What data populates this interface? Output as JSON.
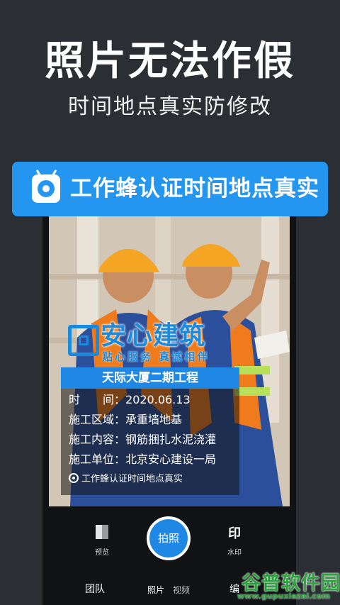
{
  "promo": {
    "headline": "照片无法作假",
    "subheadline": "时间地点真实防修改"
  },
  "banner": {
    "icon": "camera-icon",
    "text": "工作蜂认证时间地点真实"
  },
  "watermark": {
    "brand": "安心建筑",
    "slogan": "贴心服务 真诚相伴",
    "project_title": "天际大厦二期工程",
    "rows": [
      {
        "label": "时　　间：",
        "value": "2020.06.13"
      },
      {
        "label": "施工区域：",
        "value": "承重墙地基"
      },
      {
        "label": "施工内容：",
        "value": "钢筋捆扎水泥浇灌"
      },
      {
        "label": "施工单位：",
        "value": "北京安心建设一局"
      }
    ],
    "footer": "工作蜂认证时间地点真实"
  },
  "camera": {
    "preview_label": "预览",
    "shutter_label": "拍照",
    "stamp_icon_text": "印",
    "watermark_label": "水印"
  },
  "tabs": {
    "team": "团队",
    "photo": "照片",
    "video": "视频",
    "edit": "编"
  },
  "site_watermark": {
    "name": "谷普软件园",
    "url": "www.gupuxiazai.com",
    "color": "#2aa33d"
  },
  "colors": {
    "accent": "#2496f0",
    "background": "#2b2e33"
  }
}
